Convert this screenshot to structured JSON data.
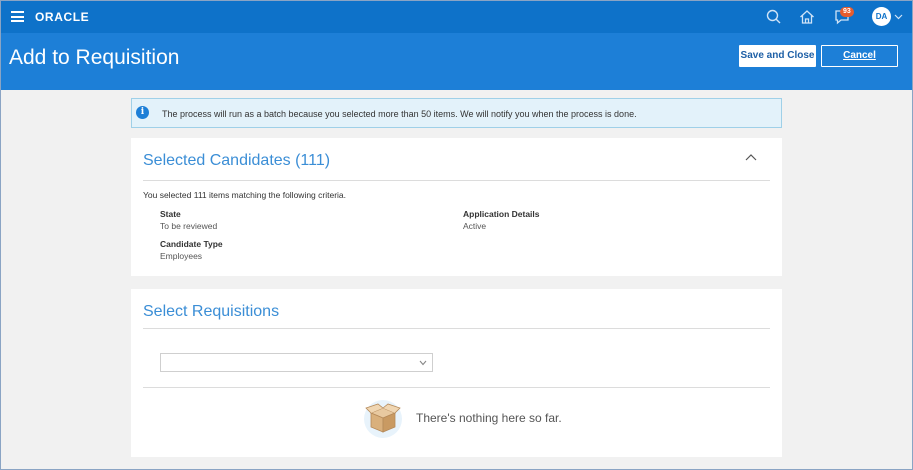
{
  "navbar": {
    "logo": "ORACLE",
    "notification_count": "93",
    "user_initials": "DA"
  },
  "header": {
    "title": "Add to Requisition",
    "save_label": "Save and Close",
    "cancel_label": "Cancel"
  },
  "banner": {
    "message": "The process will run as a batch because you selected more than 50 items. We will notify you when the process is done."
  },
  "selected_candidates": {
    "title": "Selected Candidates (111)",
    "summary": "You selected 111 items matching the following criteria.",
    "criteria": [
      {
        "label": "State",
        "value": "To be reviewed"
      },
      {
        "label": "Application Details",
        "value": "Active"
      },
      {
        "label": "Candidate Type",
        "value": "Employees"
      }
    ]
  },
  "select_requisitions": {
    "title": "Select Requisitions",
    "select_value": "",
    "empty_message": "There's nothing here so far."
  },
  "colors": {
    "navbar": "#0e72c9",
    "titlebar": "#1d7fd7",
    "accent_text": "#3b8ed6",
    "badge": "#e65c2e"
  }
}
